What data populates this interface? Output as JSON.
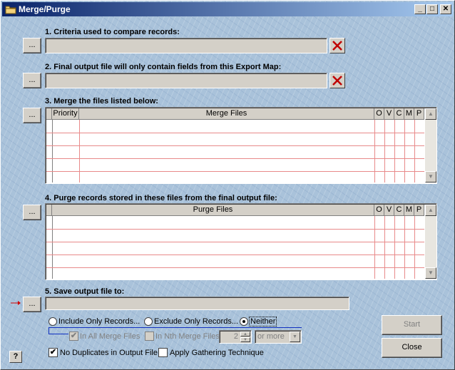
{
  "window": {
    "title": "Merge/Purge",
    "icon": "folder-icon"
  },
  "titlebar_buttons": {
    "minimize": "_",
    "maximize": "□",
    "close": "✕"
  },
  "browse_label": "...",
  "criteria": {
    "label": "1. Criteria used to compare records:",
    "value": ""
  },
  "export_map": {
    "label": "2. Final output file will only contain fields from this Export Map:",
    "value": ""
  },
  "merge": {
    "label": "3. Merge the files listed below:",
    "columns": [
      "Priority",
      "Merge Files",
      "O",
      "V",
      "C",
      "M",
      "P"
    ]
  },
  "purge": {
    "label": "4. Purge records stored in these files from the final output file:",
    "columns": [
      "Purge Files",
      "O",
      "V",
      "C",
      "M",
      "P"
    ]
  },
  "output": {
    "label": "5. Save output file to:",
    "value": ""
  },
  "options": {
    "include_only": "Include Only Records...",
    "exclude_only": "Exclude Only Records...",
    "neither": "Neither",
    "selected": "Neither",
    "in_all_merge_files": "In All Merge Files",
    "in_all_checked": true,
    "in_nth_merge_files": "In Nth Merge Files",
    "in_nth_checked": false,
    "nth_value": "2",
    "nth_mode": "or more",
    "no_duplicates": "No Duplicates in Output File",
    "no_duplicates_checked": true,
    "apply_gathering": "Apply Gathering Technique",
    "apply_gathering_checked": false
  },
  "buttons": {
    "start": "Start",
    "close": "Close",
    "help": "?"
  }
}
